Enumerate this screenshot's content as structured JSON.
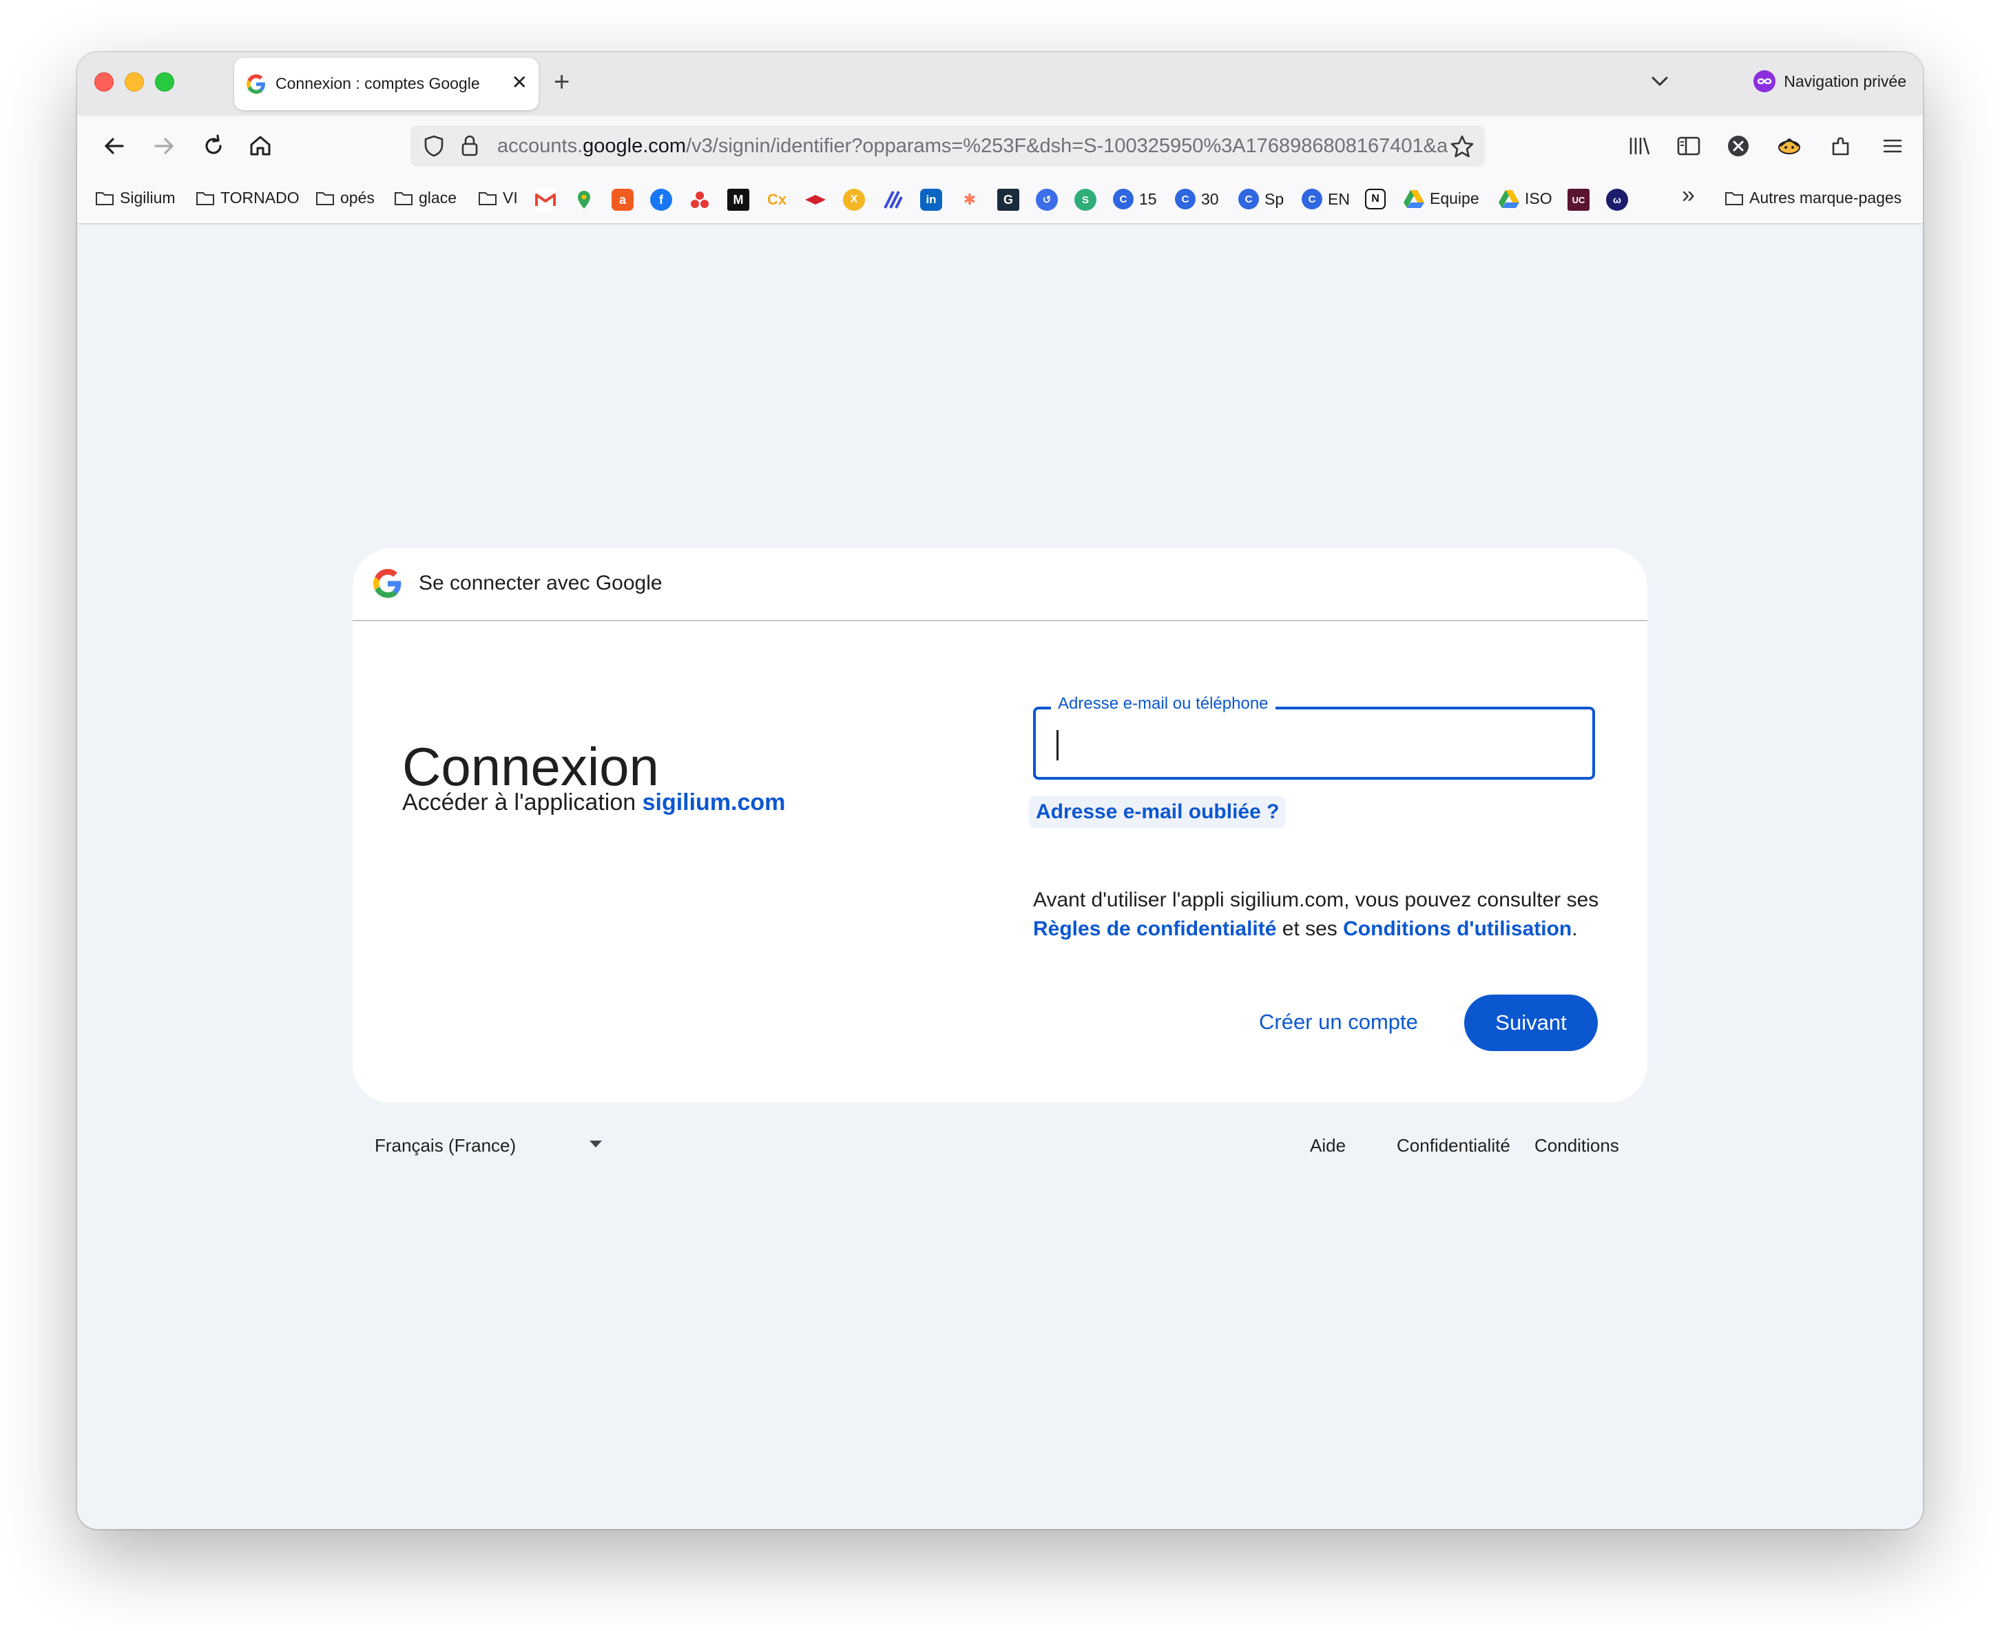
{
  "tab": {
    "title": "Connexion : comptes Google",
    "close": "✕",
    "new": "+"
  },
  "private": {
    "label": "Navigation privée"
  },
  "url": {
    "prefix": "accounts.",
    "domain": "google.com",
    "rest": "/v3/signin/identifier?opparams=%253F&dsh=S-100325950%3A1768986808167401&a"
  },
  "bookmarks": {
    "folders": [
      "Sigilium",
      "TORNADO",
      "opés",
      "glace",
      "VI"
    ],
    "counts": [
      "15",
      "30",
      "Sp",
      "EN"
    ],
    "equipe": "Equipe",
    "iso": "ISO",
    "uc": "UC",
    "other": "Autres marque-pages",
    "overflow": "»"
  },
  "card": {
    "header": "Se connecter avec Google",
    "heading": "Connexion",
    "subtitle_prefix": "Accéder à l'application ",
    "subtitle_link": "sigilium.com",
    "field_label": "Adresse e-mail ou téléphone",
    "field_value": "",
    "forgot": "Adresse e-mail oubliée ?",
    "privacy_text1": "Avant d'utiliser l'appli sigilium.com, vous pouvez consulter ses ",
    "privacy_link1": "Règles de confidentialité",
    "privacy_text2": " et ses ",
    "privacy_link2": "Conditions d'utilisation",
    "privacy_text3": ".",
    "create": "Créer un compte",
    "next": "Suivant"
  },
  "footer": {
    "language": "Français (France)",
    "help": "Aide",
    "privacy": "Confidentialité",
    "terms": "Conditions"
  },
  "colors": {
    "accent": "#0b57d0",
    "page_bg": "#f0f4f9",
    "private": "#8b2fe0"
  }
}
